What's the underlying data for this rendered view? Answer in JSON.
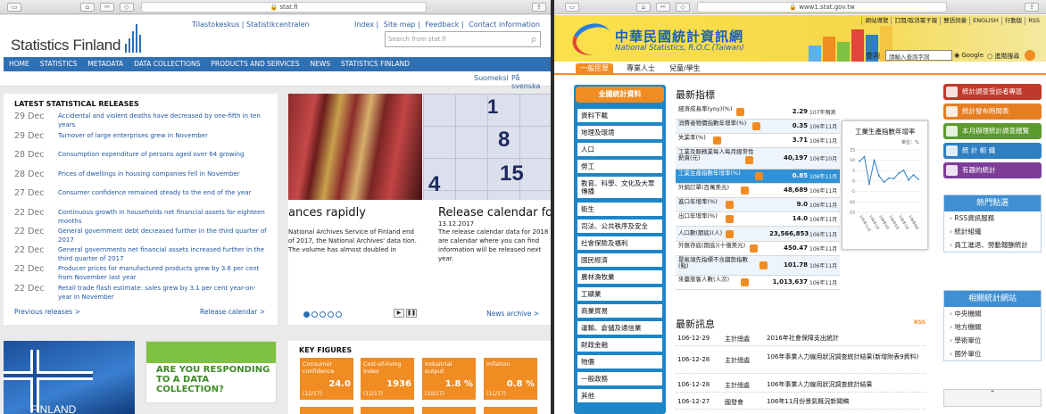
{
  "browser_left": {
    "url": "stat.fi"
  },
  "browser_right": {
    "url": "www1.stat.gov.tw"
  },
  "sf": {
    "logo": "Statistics Finland",
    "lang_links": [
      "Tilastokeskus",
      "Statistikcentralen"
    ],
    "top_links": [
      "Index",
      "Site map",
      "Feedback",
      "Contact information"
    ],
    "search_placeholder": "Search from stat.fi",
    "nav": [
      "HOME",
      "STATISTICS",
      "METADATA",
      "DATA COLLECTIONS",
      "PRODUCTS AND SERVICES",
      "NEWS",
      "STATISTICS FINLAND"
    ],
    "sub_langs": [
      "Suomeksi",
      "På svenska"
    ],
    "releases_title": "LATEST STATISTICAL RELEASES",
    "releases": [
      {
        "date": "29 Dec",
        "text": "Accidental and violent deaths have decreased by one-fifth in ten years"
      },
      {
        "date": "29 Dec",
        "text": "Turnover of large enterprises grew in November"
      },
      {
        "date": "28 Dec",
        "text": "Consumption expenditure of persons aged over 64 growing"
      },
      {
        "date": "28 Dec",
        "text": "Prices of dwellings in housing companies fell in November"
      },
      {
        "date": "27 Dec",
        "text": "Consumer confidence remained steady to the end of the year"
      },
      {
        "date": "22 Dec",
        "text": "Continuous growth in households net financial assets for eighteen months"
      },
      {
        "date": "22 Dec",
        "text": "General government debt decreased further in the third quarter of 2017"
      },
      {
        "date": "22 Dec",
        "text": "General governments net financial assets increased further in the third quarter of 2017"
      },
      {
        "date": "22 Dec",
        "text": "Producer prices for manufactured products grew by 3.6 per cent from November last year"
      },
      {
        "date": "22 Dec",
        "text": "Retail trade flash estimate: sales grew by 3.1 per cent year-on-year in November"
      }
    ],
    "previous_releases": "Previous releases >",
    "release_calendar": "Release calendar >",
    "news1_headline": "ances rapidly",
    "news1_text": "National Archives Service of Finland end of 2017, the National Archives' data tion. The volume has almost doubled in",
    "news2_headline": "Release calendar for 20",
    "news2_date": "13.12.2017",
    "news2_text": "The release calendar data for 2018 are calendar where you can find information will be released next year.",
    "calendar_numbers": [
      "1",
      "8",
      "4",
      "15"
    ],
    "news_archive": "News archive >",
    "play_btn": "▶",
    "pause_btn": "❚❚",
    "flag_text": "FINLAND",
    "respond": "ARE YOU RESPONDING TO A DATA COLLECTION?",
    "key_title": "KEY FIGURES",
    "key_figures": [
      {
        "label": "Consumer confidence",
        "value": "24.0",
        "date": "(12/17)"
      },
      {
        "label": "Cost-of-living Index",
        "value": "1936",
        "date": "(11/17)"
      },
      {
        "label": "Industrial output",
        "value": "1.8 %",
        "date": "(10/17)"
      },
      {
        "label": "Inflation",
        "value": "0.8 %",
        "date": "(11/17)"
      }
    ]
  },
  "tw": {
    "top_links": [
      "網站導覽",
      "訂閱/取消電子報",
      "雙語詞彙",
      "ENGLISH",
      "行動版",
      "RSS"
    ],
    "title": "中華民國統計資訊網",
    "subtitle": "National Statistics, R.O.C.(Taiwan)",
    "tabs": [
      "一般民眾",
      "專業人士",
      "兒童/學生"
    ],
    "search_label": "查詢",
    "search_placeholder": "請輸入查詢字詞",
    "radio_google": "Google",
    "radio_advanced": "進階搜尋",
    "left_title": "全國統計資料",
    "left_items": [
      "資料下載",
      "地理及環境",
      "人口",
      "勞工",
      "教育、科學、文化及大眾傳播",
      "衛生",
      "司法、公共秩序及安全",
      "社會保險及福利",
      "國民經濟",
      "農林漁牧業",
      "工礦業",
      "商業貿易",
      "運輸、倉儲及通信業",
      "財政金融",
      "物價",
      "一般政務",
      "其他"
    ],
    "indicators_title": "最新指標",
    "indicators": [
      {
        "name": "經濟成長率(yoy)(%)",
        "value": "2.29",
        "period": "107年預測"
      },
      {
        "name": "消費者物價指數年增率(%)",
        "value": "0.35",
        "period": "106年11月"
      },
      {
        "name": "失業率(%)",
        "value": "3.71",
        "period": "106年11月"
      },
      {
        "name": "工業及服務業每人每月經常性薪資(元)",
        "value": "40,197",
        "period": "106年10月"
      },
      {
        "name": "工業生產指數年增率(%)",
        "value": "0.85",
        "period": "106年11月"
      },
      {
        "name": "外銷訂單(百萬美元)",
        "value": "48,689",
        "period": "106年11月"
      },
      {
        "name": "進口年增率(%)",
        "value": "9.0",
        "period": "106年11月"
      },
      {
        "name": "出口年增率(%)",
        "value": "14.0",
        "period": "106年11月"
      },
      {
        "name": "人口數(期底)(人)",
        "value": "23,566,853",
        "period": "106年11月"
      },
      {
        "name": "外匯存底(期底)(十億美元)",
        "value": "450.47",
        "period": "106年11月"
      },
      {
        "name": "景氣領先指標不含趨勢指數(點)",
        "value": "101.78",
        "period": "106年11月"
      },
      {
        "name": "來臺旅客人數(人次)",
        "value": "1,013,637",
        "period": "106年11月"
      }
    ],
    "chart_title": "工業生產指數年增率",
    "chart_unit": "單位：%",
    "chart_data": {
      "type": "line",
      "title": "工業生產指數年增率",
      "ylim": [
        -15,
        15
      ],
      "y_ticks": [
        15,
        10,
        5,
        0,
        -5,
        -10,
        -15
      ],
      "x_labels": [
        "105年11月",
        "106年1月",
        "106年3月",
        "106年5月",
        "106年7月",
        "106年9月"
      ],
      "values": [
        9.5,
        11.8,
        -1.5,
        10.0,
        2.5,
        -0.5,
        1.5,
        1.2,
        3.8,
        5.2,
        0.5,
        3.0,
        0.85
      ]
    },
    "news_title": "最新訊息",
    "rss_label": "RSS",
    "news": [
      {
        "date": "106-12-29",
        "org": "主計總處",
        "title": "2016年社會保障支出統計"
      },
      {
        "date": "106-12-28",
        "org": "主計總處",
        "title": "106年事業人力僱用狀況調查統計結果(新增附表9資料)"
      },
      {
        "date": "106-12-28",
        "org": "主計總處",
        "title": "106年事業人力僱用狀況調查統計結果"
      },
      {
        "date": "106-12-27",
        "org": "國發會",
        "title": "106年11月份景氣概況新聞稿"
      }
    ],
    "right_buttons": [
      {
        "label": "統計調查受訪者專區",
        "color": "#c0392b"
      },
      {
        "label": "統計發布時間表",
        "color": "#e67e22"
      },
      {
        "label": "本月辦理統計調查總覽",
        "color": "#5b9a2d"
      },
      {
        "label": "統 計 組 織",
        "color": "#2f7fc1"
      },
      {
        "label": "有趣的統計",
        "color": "#7d3c98"
      }
    ],
    "hot_title": "熱門點選",
    "hot_items": [
      "RSS資訊服務",
      "統計組織",
      "員工進退、勞動報酬統計"
    ],
    "related_title": "相關統計網站",
    "related_items": [
      "中央機關",
      "地方機關",
      "學術單位",
      "國外單位"
    ]
  }
}
